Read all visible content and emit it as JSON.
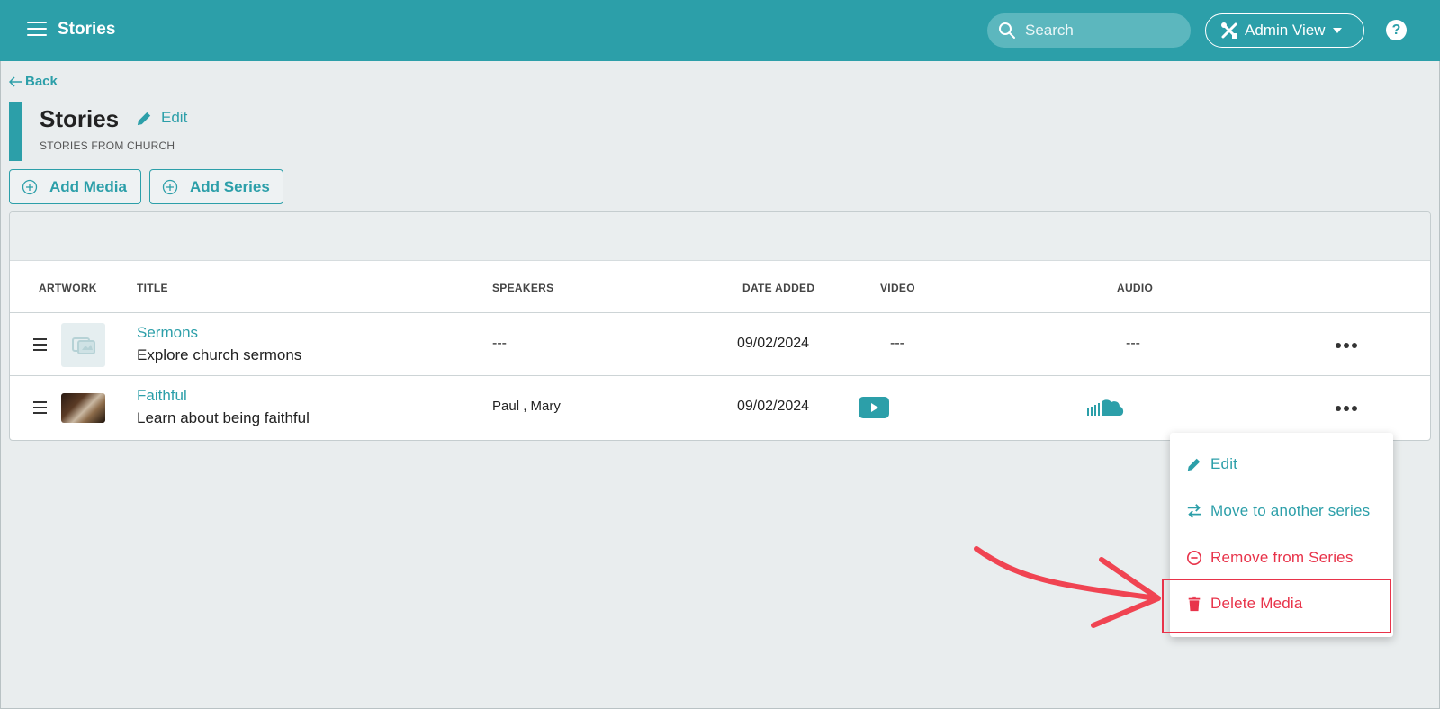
{
  "header": {
    "app_title": "Stories",
    "search_placeholder": "Search",
    "admin_label": "Admin View",
    "help_label": "?"
  },
  "page": {
    "back_label": "Back",
    "title": "Stories",
    "edit_label": "Edit",
    "subtitle": "STORIES FROM CHURCH",
    "add_media_label": "Add Media",
    "add_series_label": "Add Series"
  },
  "table": {
    "columns": [
      "ARTWORK",
      "TITLE",
      "SPEAKERS",
      "DATE ADDED",
      "VIDEO",
      "AUDIO"
    ],
    "rows": [
      {
        "title": "Sermons",
        "description": "Explore church sermons",
        "speakers": "---",
        "date_added": "09/02/2024",
        "video": "---",
        "audio": "---"
      },
      {
        "title": "Faithful",
        "description": "Learn about being faithful",
        "speakers": "Paul , Mary",
        "date_added": "09/02/2024",
        "video": "youtube-icon",
        "audio": "soundcloud-icon"
      }
    ]
  },
  "context_menu": {
    "items": [
      {
        "label": "Edit",
        "icon": "pencil-icon",
        "color": "#2c9fa9"
      },
      {
        "label": "Move to another series",
        "icon": "swap-arrows-icon",
        "color": "#2c9fa9"
      },
      {
        "label": "Remove from Series",
        "icon": "minus-circle-icon",
        "color": "#e8334a"
      },
      {
        "label": "Delete Media",
        "icon": "trash-icon",
        "color": "#e8334a"
      }
    ]
  },
  "colors": {
    "accent": "#2c9fa9",
    "danger": "#e8334a",
    "background": "#e9edee"
  }
}
